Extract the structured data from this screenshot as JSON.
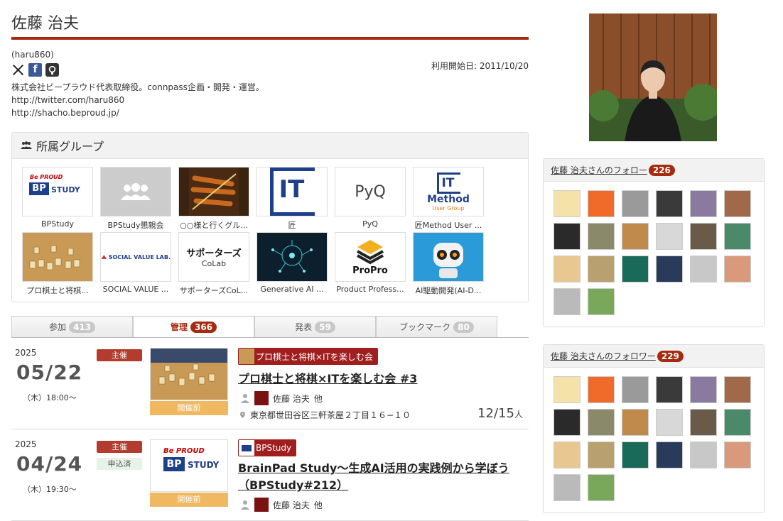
{
  "profile": {
    "name": "佐藤 治夫",
    "handle": "(haru860)",
    "started": "利用開始日: 2011/10/20",
    "bio": [
      "株式会社ビープラウド代表取締役。connpass企画・開発・運営。",
      "http://twitter.com/haru860",
      "http://shacho.beproud.jp/"
    ],
    "icons": [
      "x-icon",
      "facebook-icon",
      "github-icon"
    ]
  },
  "groups": {
    "title": "所属グループ",
    "items": [
      {
        "name": "BPStudy"
      },
      {
        "name": "BPStudy懇親会"
      },
      {
        "name": "○○様と行くグル..."
      },
      {
        "name": "匠"
      },
      {
        "name": "PyQ"
      },
      {
        "name": "匠Method User ..."
      },
      {
        "name": "プロ棋士と将棋..."
      },
      {
        "name": "SOCIAL VALUE ..."
      },
      {
        "name": "サポーターズCoL..."
      },
      {
        "name": "Generative AI ..."
      },
      {
        "name": "Product Profess..."
      },
      {
        "name": "AI駆動開発(AI-D..."
      }
    ],
    "logo_texts": {
      "bp": "BP",
      "study": "STUDY",
      "be": "Be PROUD",
      "it": "IT",
      "method": "Method",
      "user_group": "User Group",
      "pyq": "PyQ",
      "svl": "SOCIAL VALUE LAB.",
      "supporters": "サポーターズ",
      "colab": "CoLab",
      "propro": "ProPro"
    }
  },
  "tabs": [
    {
      "label": "参加",
      "count": "413",
      "active": false
    },
    {
      "label": "管理",
      "count": "366",
      "active": true
    },
    {
      "label": "発表",
      "count": "59",
      "active": false
    },
    {
      "label": "ブックマーク",
      "count": "80",
      "active": false
    }
  ],
  "events": [
    {
      "year": "2025",
      "date": "05/22",
      "time": "（木）18:00〜",
      "role": "主催",
      "applied": "",
      "status": "開催前",
      "group": "プロ棋士と将棋×ITを楽しむ会",
      "title": "プロ棋士と将棋×ITを楽しむ会 #3",
      "owner": "佐藤 治夫",
      "others": "他",
      "place": "東京都世田谷区三軒茶屋２丁目１６−１０",
      "people": "12/15",
      "people_unit": "人"
    },
    {
      "year": "2025",
      "date": "04/24",
      "time": "（木）19:30〜",
      "role": "主催",
      "applied": "申込済",
      "status": "開催前",
      "group": "BPStudy",
      "title": "BrainPad Study〜生成AI活用の実践例から学ぼう（BPStudy#212）",
      "owner": "佐藤 治夫",
      "others": "他",
      "place": "",
      "people": "",
      "people_unit": ""
    }
  ],
  "following": {
    "title": "佐藤 治夫さんのフォロー",
    "count": "226"
  },
  "followers": {
    "title": "佐藤 治夫さんのフォロワー",
    "count": "229"
  },
  "colors": {
    "accent": "#a52a0e",
    "host_badge": "#b33c2e",
    "status": "#f0b860"
  }
}
